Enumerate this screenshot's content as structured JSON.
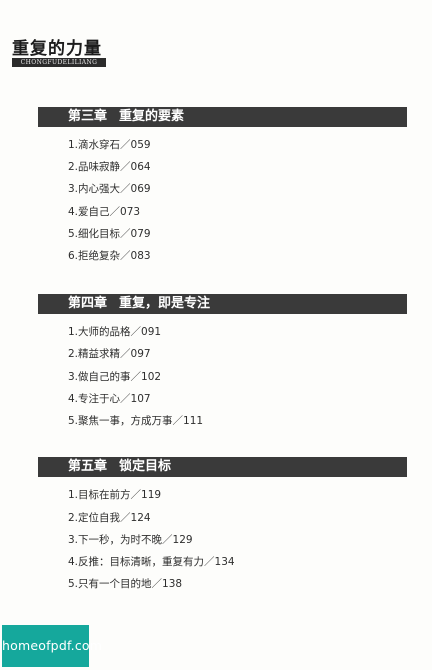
{
  "book": {
    "title": "重复的力量",
    "subtitle": "CHONGFUDELILIANG"
  },
  "chapters": [
    {
      "number": "第三章",
      "name": "重复的要素",
      "entries": [
        "1.滴水穿石／059",
        "2.品味寂静／064",
        "3.内心强大／069",
        "4.爱自己／073",
        "5.细化目标／079",
        "6.拒绝复杂／083"
      ]
    },
    {
      "number": "第四章",
      "name": "重复，即是专注",
      "entries": [
        "1.大师的品格／091",
        "2.精益求精／097",
        "3.做自己的事／102",
        "4.专注于心／107",
        "5.聚焦一事，方成万事／111"
      ]
    },
    {
      "number": "第五章",
      "name": "锁定目标",
      "entries": [
        "1.目标在前方／119",
        "2.定位自我／124",
        "3.下一秒，为时不晚／129",
        "4.反推：目标清晰，重复有力／134",
        "5.只有一个目的地／138"
      ]
    }
  ],
  "watermark": "homeofpdf.com"
}
